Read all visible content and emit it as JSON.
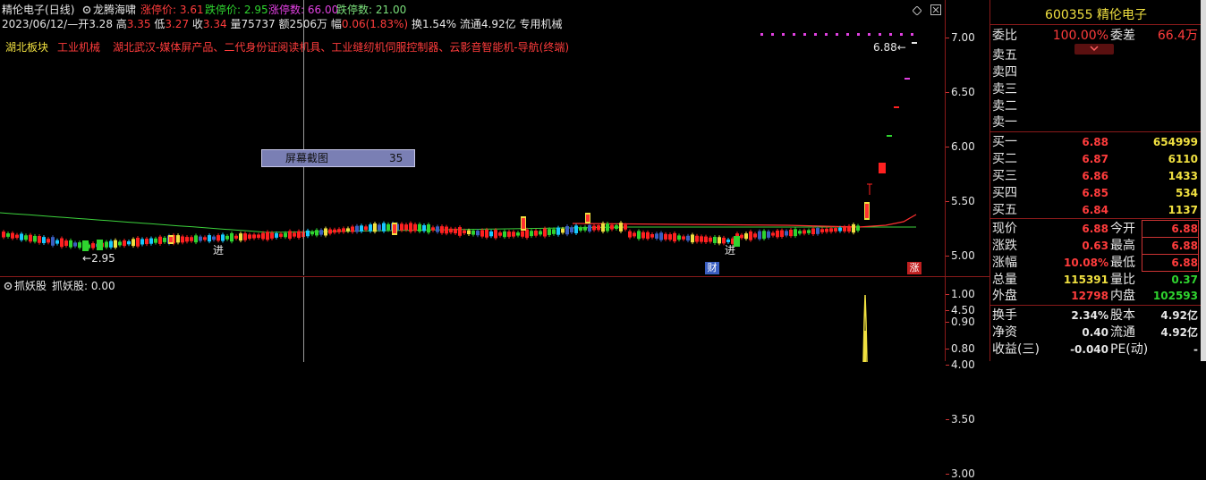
{
  "header": {
    "stock_name": "精伦电子",
    "period": "(日线)",
    "indicator_name": "龙腾海啸",
    "limit_up_label": "涨停价:",
    "limit_up_value": "3.61",
    "limit_down_label": "跌停价:",
    "limit_down_value": "2.95",
    "up_count_label": "涨停数:",
    "up_count_value": "66.00",
    "down_count_label": "跌停数:",
    "down_count_value": "21.00"
  },
  "info_line": {
    "date": "2023/06/12/—",
    "open_label": "开",
    "open": "3.28",
    "high_label": "高",
    "high": "3.35",
    "low_label": "低",
    "low": "3.27",
    "close_label": "收",
    "close": "3.34",
    "vol_label": "量",
    "vol": "75737",
    "amt_label": "额",
    "amt": "2506万",
    "chg_label": "幅",
    "chg": "0.06(1.83%)",
    "turnover_label": "换",
    "turnover": "1.54%",
    "float_label": "流通",
    "float": "4.92亿",
    "sector": "专用机械"
  },
  "concept_line": {
    "region": "湖北板块",
    "industry": "工业机械",
    "concepts": "湖北武汉-媒体屏产品、二代身份证阅读机具、工业缝纫机伺服控制器、云影音智能机-导航(终端)"
  },
  "chart_annotations": {
    "low_marker": "2.95",
    "high_marker": "6.88",
    "buy_signal_1": "进",
    "buy_signal_2": "进",
    "finance_badge": "财",
    "limit_badge": "涨"
  },
  "overlay_box": {
    "label": "屏幕截图",
    "count": "35"
  },
  "sub_indicator": {
    "title": "抓妖股",
    "line_label": "抓妖股:",
    "line_value": "0.00"
  },
  "price_axis": [
    "7.00",
    "6.50",
    "6.00",
    "5.50",
    "5.00",
    "4.50",
    "4.00",
    "3.50",
    "3.00"
  ],
  "sub_axis": [
    "1.00",
    "0.90",
    "0.80"
  ],
  "quote": {
    "code": "600355",
    "name": "精伦电子",
    "weibi_label": "委比",
    "weibi": "100.00%",
    "weicha_label": "委差",
    "weicha": "66.4万",
    "sells": [
      {
        "label": "卖五",
        "price": "",
        "vol": ""
      },
      {
        "label": "卖四",
        "price": "",
        "vol": ""
      },
      {
        "label": "卖三",
        "price": "",
        "vol": ""
      },
      {
        "label": "卖二",
        "price": "",
        "vol": ""
      },
      {
        "label": "卖一",
        "price": "",
        "vol": ""
      }
    ],
    "buys": [
      {
        "label": "买一",
        "price": "6.88",
        "vol": "654999"
      },
      {
        "label": "买二",
        "price": "6.87",
        "vol": "6110"
      },
      {
        "label": "买三",
        "price": "6.86",
        "vol": "1433"
      },
      {
        "label": "买四",
        "price": "6.85",
        "vol": "534"
      },
      {
        "label": "买五",
        "price": "6.84",
        "vol": "1137"
      }
    ],
    "stats": [
      {
        "l1": "现价",
        "v1": "6.88",
        "l2": "今开",
        "v2": "6.88"
      },
      {
        "l1": "涨跌",
        "v1": "0.63",
        "l2": "最高",
        "v2": "6.88"
      },
      {
        "l1": "涨幅",
        "v1": "10.08%",
        "l2": "最低",
        "v2": "6.88"
      },
      {
        "l1": "总量",
        "v1": "115391",
        "l2": "量比",
        "v2": "0.37"
      },
      {
        "l1": "外盘",
        "v1": "12798",
        "l2": "内盘",
        "v2": "102593"
      }
    ],
    "extra": [
      {
        "l1": "换手",
        "v1": "2.34%",
        "l2": "股本",
        "v2": "4.92亿"
      },
      {
        "l1": "净资",
        "v1": "0.40",
        "l2": "流通",
        "v2": "4.92亿"
      },
      {
        "l1": "收益(三)",
        "v1": "-0.040",
        "l2": "PE(动)",
        "v2": "-"
      }
    ]
  },
  "colors": {
    "up": "#ff3c3c",
    "down": "#2fd42f",
    "background": "#000000",
    "border": "#8a1a1a",
    "ma_line": "#3cd23c",
    "yellow": "#f0e040"
  }
}
